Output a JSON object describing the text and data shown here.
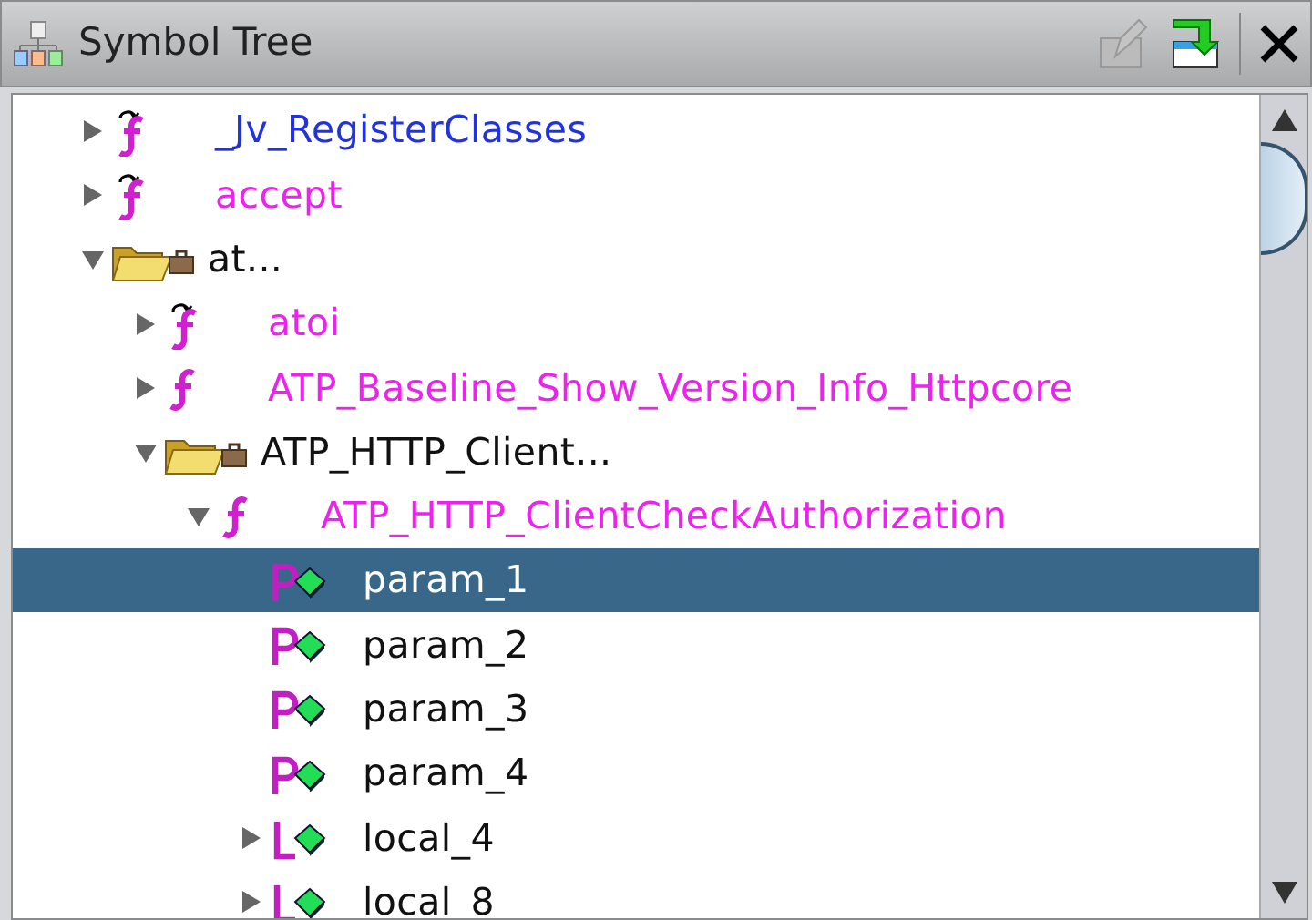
{
  "window": {
    "title": "Symbol Tree"
  },
  "tree": [
    {
      "label": "_Jv_RegisterClasses",
      "kind": "external-function",
      "color": "#2233dd",
      "expanded": false,
      "selected": false
    },
    {
      "label": "accept",
      "kind": "external-function",
      "color": "#ee22ee",
      "expanded": false,
      "selected": false
    },
    {
      "label": "at...",
      "kind": "namespace",
      "color": "#111111",
      "expanded": true,
      "selected": false,
      "children": [
        {
          "label": "atoi",
          "kind": "external-function",
          "color": "#ee22ee",
          "expanded": false,
          "selected": false
        },
        {
          "label": "ATP_Baseline_Show_Version_Info_Httpcore",
          "kind": "function",
          "color": "#ee22ee",
          "expanded": false,
          "selected": false
        },
        {
          "label": "ATP_HTTP_Client...",
          "kind": "namespace",
          "color": "#111111",
          "expanded": true,
          "selected": false,
          "children": [
            {
              "label": "ATP_HTTP_ClientCheckAuthorization",
              "kind": "function",
              "color": "#ee22ee",
              "expanded": true,
              "selected": false,
              "children": [
                {
                  "label": "param_1",
                  "kind": "parameter",
                  "color": "#ffffff",
                  "selected": true
                },
                {
                  "label": "param_2",
                  "kind": "parameter",
                  "color": "#111111",
                  "selected": false
                },
                {
                  "label": "param_3",
                  "kind": "parameter",
                  "color": "#111111",
                  "selected": false
                },
                {
                  "label": "param_4",
                  "kind": "parameter",
                  "color": "#111111",
                  "selected": false
                },
                {
                  "label": "local_4",
                  "kind": "local",
                  "color": "#111111",
                  "expanded": false,
                  "selected": false
                },
                {
                  "label": "local_8",
                  "kind": "local",
                  "color": "#111111",
                  "expanded": false,
                  "selected": false
                }
              ]
            }
          ]
        }
      ]
    }
  ]
}
